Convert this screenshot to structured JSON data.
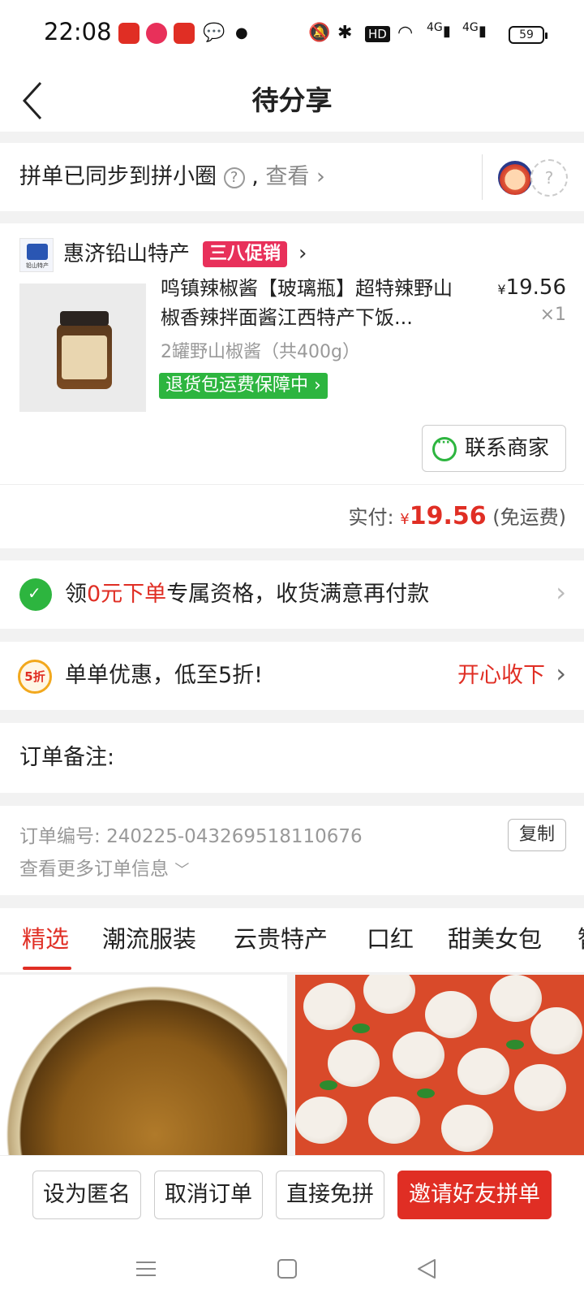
{
  "status_bar": {
    "time": "22:08",
    "battery": "59",
    "network1": "4G",
    "network2": "4G",
    "hd": "HD"
  },
  "header": {
    "title": "待分享"
  },
  "sync": {
    "text": "拼单已同步到拼小圈",
    "help": "?",
    "comma": ",",
    "view": "查看",
    "avatar_placeholder": "?"
  },
  "shop": {
    "name": "惠济铅山特产",
    "promo": "三八促销",
    "logo_caption": "铅山特产"
  },
  "product": {
    "title": "鸣镇辣椒酱【玻璃瓶】超特辣野山椒香辣拌面酱江西特产下饭...",
    "price_symbol": "¥",
    "price": "19.56",
    "qty": "×1",
    "spec": "2罐野山椒酱（共400g）",
    "guarantee": "退货包运费保障中",
    "contact": "联系商家"
  },
  "payment": {
    "label": "实付:",
    "symbol": "¥",
    "amount": "19.56",
    "note": "(免运费)"
  },
  "zero_order": {
    "prefix": "领",
    "highlight": "0元下单",
    "suffix": "专属资格，收货满意再付款"
  },
  "discount": {
    "badge": "5折",
    "text": "单单优惠，低至5折!",
    "action": "开心收下"
  },
  "remark": {
    "label": "订单备注:"
  },
  "order_info": {
    "number_label": "订单编号:",
    "number": "240225-043269518110676",
    "copy": "复制",
    "more": "查看更多订单信息"
  },
  "tabs": [
    "精选",
    "潮流服装",
    "云贵特产",
    "口红",
    "甜美女包",
    "智"
  ],
  "actions": {
    "anonymous": "设为匿名",
    "cancel": "取消订单",
    "direct": "直接免拼",
    "invite": "邀请好友拼单"
  },
  "colors": {
    "accent_red": "#e02e24",
    "green": "#2db53f",
    "promo_pink": "#e8305a"
  }
}
